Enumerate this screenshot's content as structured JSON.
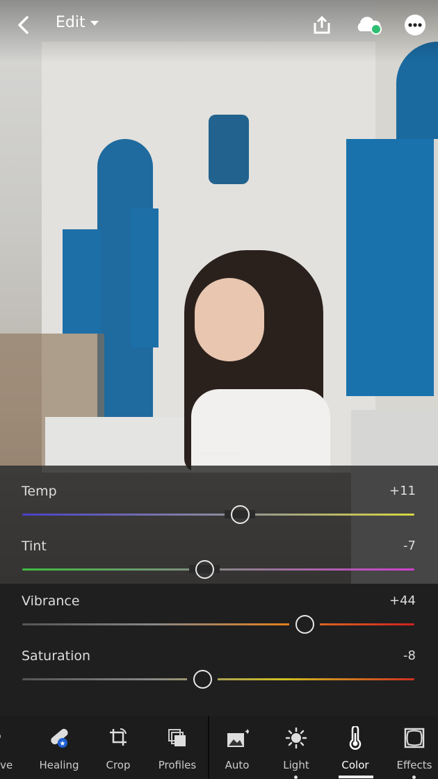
{
  "header": {
    "back_icon": "chevron-left-icon",
    "title": "Edit",
    "title_icon": "caret-down-icon",
    "share_icon": "share-icon",
    "cloud_icon": "cloud-sync-icon",
    "cloud_status_color": "#2fbf71",
    "more_icon": "more-horizontal-icon"
  },
  "panel": {
    "sliders": [
      {
        "label": "Temp",
        "value": "+11",
        "numeric": 11,
        "min": -100,
        "max": 100,
        "gradient": [
          "#4a3fc8",
          "#8a8aa0",
          "#d8d840"
        ]
      },
      {
        "label": "Tint",
        "value": "-7",
        "numeric": -7,
        "min": -100,
        "max": 100,
        "gradient": [
          "#3fbf3f",
          "#888888",
          "#d040d0"
        ]
      },
      {
        "label": "Vibrance",
        "value": "+44",
        "numeric": 44,
        "min": -100,
        "max": 100,
        "gradient": [
          "#555555",
          "#888888",
          "#e08020",
          "#d02020"
        ]
      },
      {
        "label": "Saturation",
        "value": "-8",
        "numeric": -8,
        "min": -100,
        "max": 100,
        "gradient": [
          "#555555",
          "#888888",
          "#d0c020",
          "#d03020"
        ]
      }
    ]
  },
  "toolbar": {
    "active": "Color",
    "tools": [
      {
        "label": "ctive",
        "icon": "selective-icon"
      },
      {
        "label": "Healing",
        "icon": "healing-bandage-icon"
      },
      {
        "label": "Crop",
        "icon": "crop-icon"
      },
      {
        "label": "Profiles",
        "icon": "profiles-icon"
      },
      {
        "label": "Auto",
        "icon": "auto-image-icon"
      },
      {
        "label": "Light",
        "icon": "sun-icon"
      },
      {
        "label": "Color",
        "icon": "thermometer-icon"
      },
      {
        "label": "Effects",
        "icon": "effects-vignette-icon"
      }
    ]
  }
}
